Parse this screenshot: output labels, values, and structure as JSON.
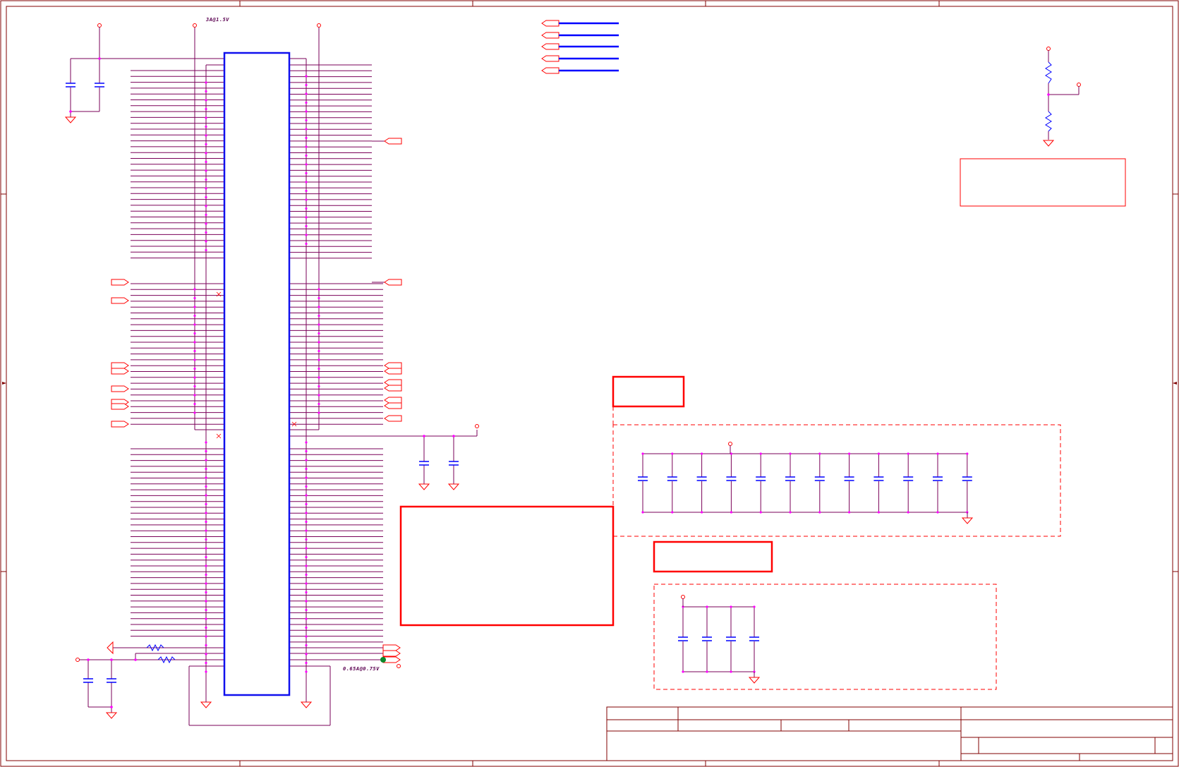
{
  "schematic": {
    "annotations": {
      "top_rail": "3A@1.5V",
      "bottom_rail": "0.65A@0.75V"
    },
    "colors": {
      "frame": "#800000",
      "wire": "#7a0058",
      "net": "#a0005a",
      "component": "#0000ff",
      "body": "#1010ee",
      "junction": "#ff00ff",
      "port": "#ff0000",
      "highlight_box": "#ff0000",
      "marker": "#0a8a2a"
    }
  }
}
